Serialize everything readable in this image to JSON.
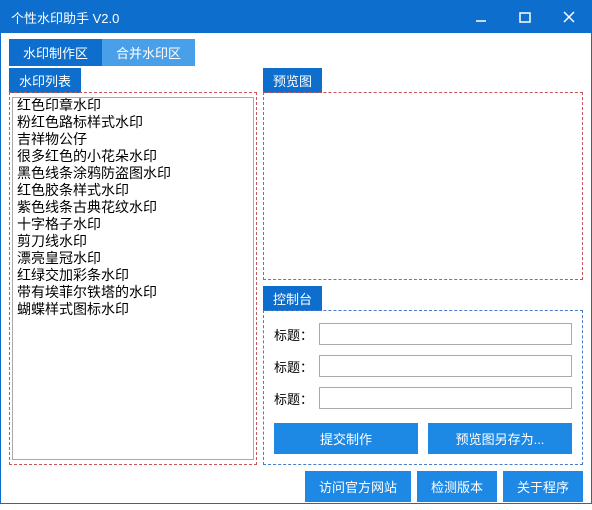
{
  "window": {
    "title": "个性水印助手 V2.0"
  },
  "tabs": {
    "active": "水印制作区",
    "inactive": "合并水印区"
  },
  "panels": {
    "list": "水印列表",
    "preview": "预览图",
    "control": "控制台"
  },
  "watermarks": [
    "红色印章水印",
    "粉红色路标样式水印",
    "吉祥物公仔",
    "很多红色的小花朵水印",
    "黑色线条涂鸦防盗图水印",
    "红色胶条样式水印",
    "紫色线条古典花纹水印",
    "十字格子水印",
    "剪刀线水印",
    "漂亮皇冠水印",
    "红绿交加彩条水印",
    "带有埃菲尔铁塔的水印",
    "蝴蝶样式图标水印"
  ],
  "form": {
    "label1": "标题：",
    "label2": "标题：",
    "label3": "标题：",
    "val1": "",
    "val2": "",
    "val3": ""
  },
  "buttons": {
    "submit": "提交制作",
    "saveAs": "预览图另存为...",
    "visit": "访问官方网站",
    "check": "检测版本",
    "about": "关于程序"
  }
}
